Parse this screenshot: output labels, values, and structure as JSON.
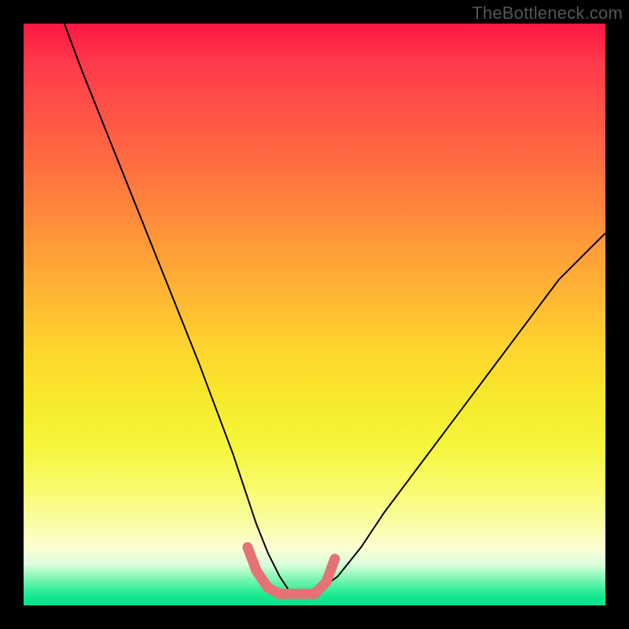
{
  "watermark": {
    "text": "TheBottleneck.com"
  },
  "chart_data": {
    "type": "line",
    "title": "",
    "xlabel": "",
    "ylabel": "",
    "xlim": [
      0,
      100
    ],
    "ylim": [
      0,
      100
    ],
    "grid": false,
    "legend": false,
    "annotations": [],
    "background_gradient_stops": [
      {
        "pct": 0,
        "color": "#ff1744"
      },
      {
        "pct": 7,
        "color": "#ff3b4b"
      },
      {
        "pct": 15,
        "color": "#ff5246"
      },
      {
        "pct": 28,
        "color": "#ff7a3e"
      },
      {
        "pct": 42,
        "color": "#ffa736"
      },
      {
        "pct": 56,
        "color": "#ffd52e"
      },
      {
        "pct": 64,
        "color": "#f7e82c"
      },
      {
        "pct": 72,
        "color": "#f5f53a"
      },
      {
        "pct": 80,
        "color": "#f9fb6e"
      },
      {
        "pct": 86,
        "color": "#fbfda6"
      },
      {
        "pct": 90,
        "color": "#fdfed2"
      },
      {
        "pct": 93,
        "color": "#d9fddc"
      },
      {
        "pct": 95,
        "color": "#8ef7b8"
      },
      {
        "pct": 97,
        "color": "#42f0a0"
      },
      {
        "pct": 98.5,
        "color": "#13e88f"
      },
      {
        "pct": 100,
        "color": "#07e38a"
      }
    ],
    "series": [
      {
        "name": "bottleneck-curve",
        "color": "#000000",
        "stroke_width": 2,
        "x": [
          7,
          10,
          14,
          18,
          22,
          26,
          30,
          33,
          36,
          38,
          40,
          42,
          44,
          46,
          50,
          54,
          58,
          62,
          68,
          74,
          80,
          86,
          92,
          98,
          100
        ],
        "values": [
          100,
          92,
          82,
          72,
          62,
          52,
          42,
          34,
          26,
          20,
          14,
          9,
          5,
          2,
          2,
          5,
          10,
          16,
          24,
          32,
          40,
          48,
          56,
          62,
          64
        ]
      },
      {
        "name": "optimal-band-marker",
        "color": "#e57373",
        "stroke_width": 13,
        "stroke_linecap": "round",
        "x": [
          38.5,
          40,
          42,
          44,
          46,
          48,
          50,
          52,
          53.5
        ],
        "values": [
          10,
          6,
          3,
          2,
          2,
          2,
          2,
          4,
          8
        ]
      }
    ]
  }
}
